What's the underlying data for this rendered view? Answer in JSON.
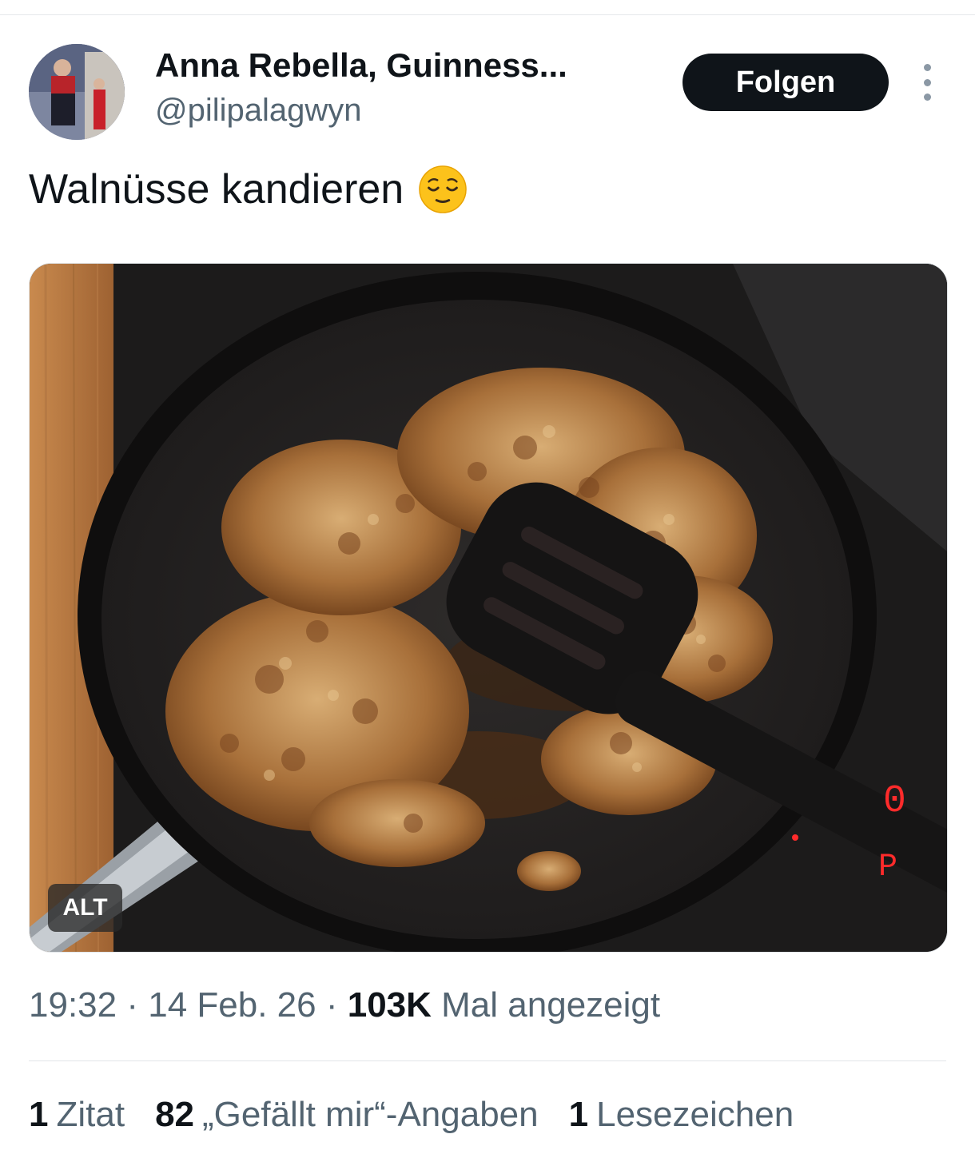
{
  "author": {
    "name": "Anna Rebella, Guinness...",
    "handle": "@pilipalagwyn"
  },
  "follow_label": "Folgen",
  "tweet": {
    "text": "Walnüsse kandieren",
    "emoji": "relieved-face-emoji"
  },
  "media": {
    "alt_badge": "ALT",
    "stove_display_top": "0",
    "stove_display_bottom": "P"
  },
  "meta": {
    "time": "19:32",
    "date": "14 Feb. 26",
    "views_count": "103K",
    "views_label": "Mal angezeigt",
    "separator": "·"
  },
  "stats": {
    "quotes_count": "1",
    "quotes_label": "Zitat",
    "likes_count": "82",
    "likes_label": "„Gefällt mir“-Angaben",
    "bookmarks_count": "1",
    "bookmarks_label": "Lesezeichen"
  },
  "icons": {
    "more": "more-vertical-icon"
  },
  "colors": {
    "text": "#0f1419",
    "secondary": "#536471",
    "follow_bg": "#0f1419",
    "follow_text": "#ffffff"
  }
}
